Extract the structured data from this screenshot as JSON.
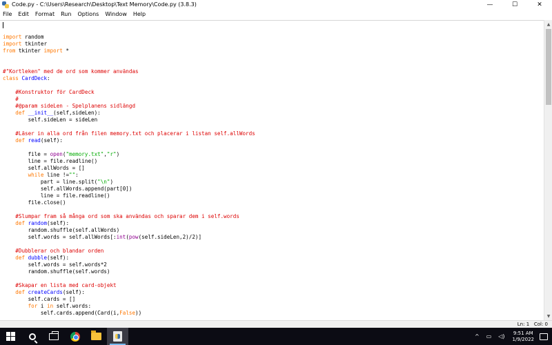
{
  "window": {
    "title": "Code.py - C:\\Users\\Research\\Desktop\\Text Memory\\Code.py (3.8.3)",
    "controls": {
      "minimize": "—",
      "maximize": "☐",
      "close": "✕"
    }
  },
  "menu": [
    "File",
    "Edit",
    "Format",
    "Run",
    "Options",
    "Window",
    "Help"
  ],
  "code_lines": [
    "",
    "import random",
    "import tkinter",
    "from tkinter import *",
    "",
    "",
    "#\"Kortleken\" med de ord som kommer användas",
    "class CardDeck:",
    "",
    "    #Konstruktor för CardDeck",
    "    #",
    "    #@param sideLen - Spelplanens sidlängd",
    "    def __init__(self,sideLen):",
    "        self.sideLen = sideLen",
    "",
    "    #Läser in alla ord från filen memory.txt och placerar i listan self.allWords",
    "    def read(self):",
    "",
    "        file = open(\"memory.txt\",\"r\")",
    "        line = file.readline()",
    "        self.allWords = []",
    "        while line !=\"\":",
    "            part = line.split(\"\\n\")",
    "            self.allWords.append(part[0])",
    "            line = file.readline()",
    "        file.close()",
    "",
    "    #Slumpar fram så många ord som ska användas och sparar dem i self.words",
    "    def random(self):",
    "        random.shuffle(self.allWords)",
    "        self.words = self.allWords[:int(pow(self.sideLen,2)/2)]",
    "",
    "    #Dubblerar och blandar orden",
    "    def dubble(self):",
    "        self.words = self.words*2",
    "        random.shuffle(self.words)",
    "",
    "    #Skapar en lista med card-objekt",
    "    def createCards(self):",
    "        self.cards = []",
    "        for i in self.words:",
    "            self.cards.append(Card(i,False))"
  ],
  "status": {
    "line": "Ln: 1",
    "col": "Col: 0"
  },
  "taskbar": {
    "apps": [
      "start-icon",
      "search-icon",
      "task-view-icon",
      "chrome-icon",
      "file-explorer-icon",
      "python-idle-icon"
    ],
    "tray": [
      "chevron-up-icon",
      "network-icon",
      "volume-icon"
    ],
    "time": "9:51 AM",
    "date": "1/9/2022"
  },
  "syntax_colors": {
    "keyword": "#ff7700",
    "comment": "#dd0000",
    "string": "#00aa00",
    "definition": "#0000ff",
    "builtin": "#900090"
  }
}
